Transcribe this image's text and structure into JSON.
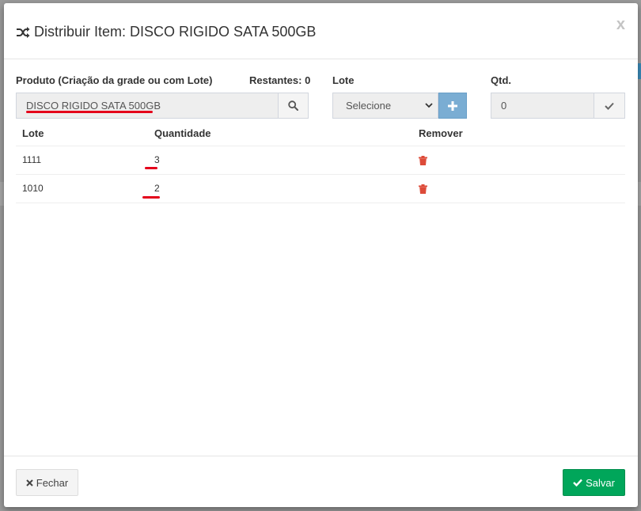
{
  "modal": {
    "title": "Distribuir Item: DISCO RIGIDO SATA 500GB",
    "close_glyph": "x"
  },
  "form": {
    "produto_label": "Produto (Criação da grade ou com Lote)",
    "restantes_label": "Restantes: 0",
    "produto_value": "DISCO RIGIDO SATA 500GB",
    "lote_label": "Lote",
    "lote_selected": "Selecione",
    "qtd_label": "Qtd.",
    "qtd_value": "0"
  },
  "table": {
    "headers": [
      "Lote",
      "Quantidade",
      "Remover"
    ],
    "rows": [
      {
        "lote": "1111",
        "quantidade": "3"
      },
      {
        "lote": "1010",
        "quantidade": "2"
      }
    ]
  },
  "footer": {
    "fechar_label": "Fechar",
    "salvar_label": "Salvar"
  },
  "icons": {
    "title": "shuffle-icon",
    "search": "search-icon",
    "plus": "plus-icon",
    "check": "check-icon",
    "remove": "trash-icon",
    "fechar": "close-icon",
    "salvar": "check-icon"
  },
  "colors": {
    "primary_btn": "#7aadd3",
    "success_btn": "#00a65a",
    "danger_icon": "#dd4b39",
    "annotation": "#e4001b"
  }
}
